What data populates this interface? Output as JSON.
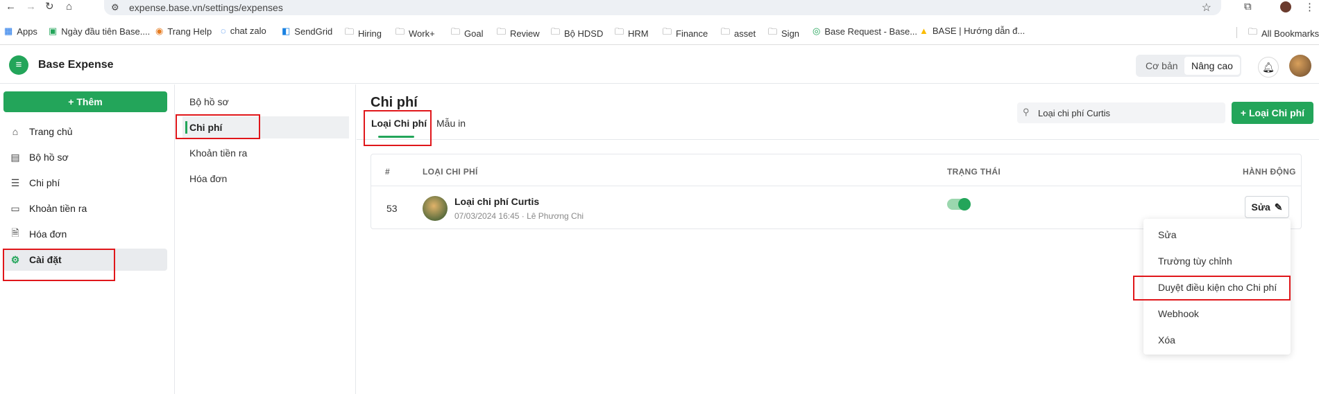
{
  "browser": {
    "url": "expense.base.vn/settings/expenses",
    "bookmarks": [
      {
        "label": "Apps",
        "icon": "apps-grid-icon"
      },
      {
        "label": "Ngày đầu tiên Base....",
        "icon": "sheets-icon"
      },
      {
        "label": "Trang Help",
        "icon": "colorful-logo-icon"
      },
      {
        "label": "chat zalo",
        "icon": "zalo-icon"
      },
      {
        "label": "SendGrid",
        "icon": "sendgrid-icon"
      },
      {
        "label": "Hiring",
        "icon": "folder-icon"
      },
      {
        "label": "Work+",
        "icon": "folder-icon"
      },
      {
        "label": "Goal",
        "icon": "folder-icon"
      },
      {
        "label": "Review",
        "icon": "folder-icon"
      },
      {
        "label": "Bộ HDSD",
        "icon": "folder-icon"
      },
      {
        "label": "HRM",
        "icon": "folder-icon"
      },
      {
        "label": "Finance",
        "icon": "folder-icon"
      },
      {
        "label": "asset",
        "icon": "folder-icon"
      },
      {
        "label": "Sign",
        "icon": "folder-icon"
      },
      {
        "label": "Base Request - Base...",
        "icon": "base-request-icon"
      },
      {
        "label": "BASE | Hướng dẫn đ...",
        "icon": "drive-icon"
      }
    ],
    "all_bookmarks": "All Bookmarks"
  },
  "header": {
    "app_title": "Base Expense",
    "mode_basic": "Cơ bản",
    "mode_advanced": "Nâng cao"
  },
  "sidebar": {
    "add_button": "+ Thêm",
    "items": [
      {
        "label": "Trang chủ",
        "icon": "home-icon"
      },
      {
        "label": "Bộ hồ sơ",
        "icon": "document-icon"
      },
      {
        "label": "Chi phí",
        "icon": "list-icon"
      },
      {
        "label": "Khoản tiền ra",
        "icon": "card-icon"
      },
      {
        "label": "Hóa đơn",
        "icon": "invoice-icon"
      },
      {
        "label": "Cài đặt",
        "icon": "gear-icon"
      }
    ]
  },
  "submenu": {
    "items": [
      "Bộ hồ sơ",
      "Chi phí",
      "Khoản tiền ra",
      "Hóa đơn"
    ]
  },
  "main": {
    "title": "Chi phí",
    "tabs": [
      "Loại Chi phí",
      "Mẫu in"
    ],
    "search_value": "Loại chi phí Curtis",
    "add_button": "+ Loại Chi phí",
    "table": {
      "headers": [
        "#",
        "LOẠI CHI PHÍ",
        "TRẠNG THÁI",
        "HÀNH ĐỘNG"
      ],
      "rows": [
        {
          "num": "53",
          "name": "Loại chi phí Curtis",
          "meta": "07/03/2024 16:45 · Lê Phương Chi",
          "status_on": true,
          "action": "Sửa"
        }
      ]
    },
    "dropdown": [
      "Sửa",
      "Trường tùy chỉnh",
      "Duyệt điều kiện cho Chi phí",
      "Webhook",
      "Xóa"
    ]
  },
  "colors": {
    "accent": "#23a55a",
    "annotation": "#e0161a"
  }
}
